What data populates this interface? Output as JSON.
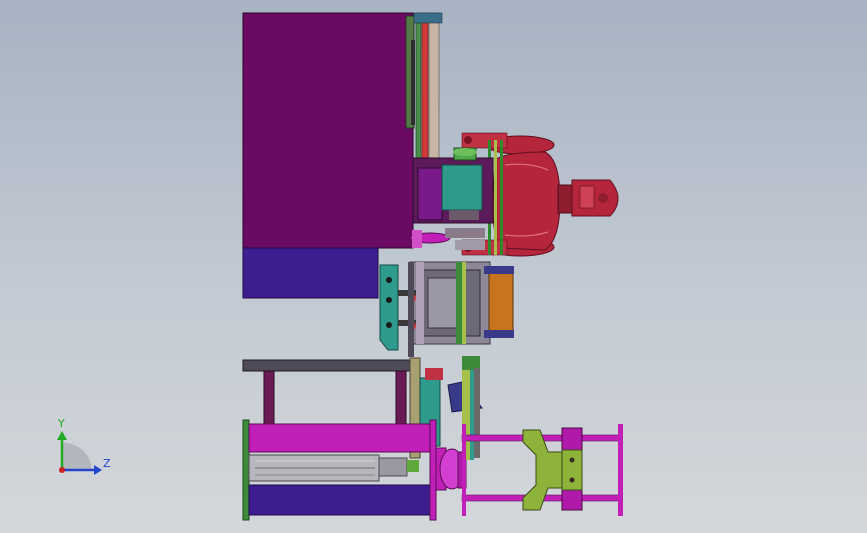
{
  "viewport": {
    "background_top": "#a7b3c3",
    "background_bottom": "#d4d7da"
  },
  "triad": {
    "y_label": "Y",
    "z_label": "Z",
    "y_color": "#22aa22",
    "z_color": "#2244cc",
    "x_color": "#cc2222"
  },
  "colors": {
    "machine_body": "#6a0a63",
    "machine_base": "#3d1d8f",
    "robot": "#b5253b",
    "robot_dark": "#8e1d2e",
    "teal": "#2f9b8c",
    "magenta": "#c21fb8",
    "frame_gray": "#4f4a58",
    "gripper": "#8db33a",
    "orange": "#c8741f",
    "green_plate": "#3c8a3a"
  }
}
